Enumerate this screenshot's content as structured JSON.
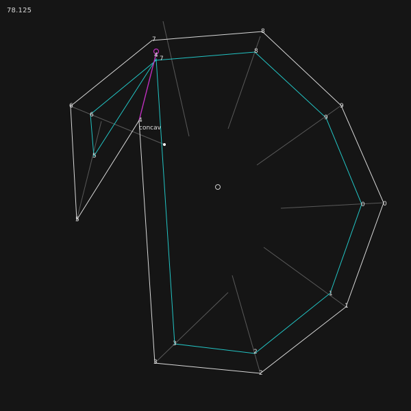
{
  "readout": "78.125",
  "annotation": "concav",
  "colors": {
    "background": "#151515",
    "outer": "#d9d9d9",
    "inner": "#22c6c6",
    "spoke": "#5a5a5a",
    "highlight": "#c030c0",
    "text": "#e0e0e0"
  },
  "outer_labels": [
    "7",
    "8",
    "9",
    "0",
    "1",
    "2",
    "3",
    "4",
    "5",
    "6"
  ],
  "inner_labels": [
    "7",
    "8",
    "9",
    "0",
    "1",
    "2",
    "3",
    "4",
    "5",
    "6"
  ]
}
